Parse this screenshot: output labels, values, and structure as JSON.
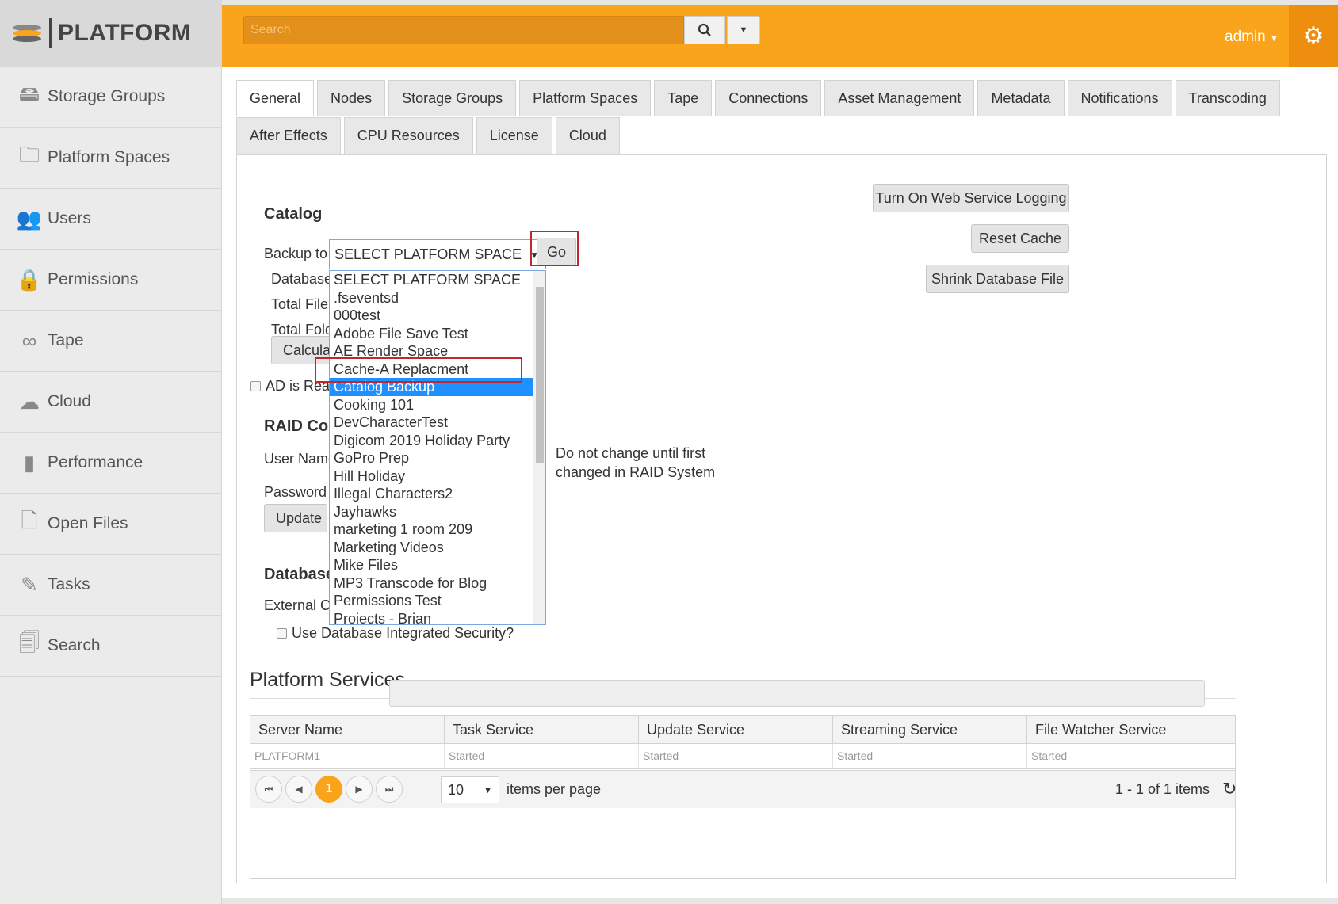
{
  "brand": {
    "logo_text": "PLATFORM"
  },
  "sidebar": {
    "items": [
      {
        "label": "Storage Groups",
        "icon": "storage-icon"
      },
      {
        "label": "Platform Spaces",
        "icon": "folder-icon"
      },
      {
        "label": "Users",
        "icon": "users-icon"
      },
      {
        "label": "Permissions",
        "icon": "lock-icon"
      },
      {
        "label": "Tape",
        "icon": "tape-icon"
      },
      {
        "label": "Cloud",
        "icon": "cloud-icon"
      },
      {
        "label": "Performance",
        "icon": "bar-chart-icon"
      },
      {
        "label": "Open Files",
        "icon": "file-icon"
      },
      {
        "label": "Tasks",
        "icon": "tasks-icon"
      },
      {
        "label": "Search",
        "icon": "search-doc-icon"
      }
    ]
  },
  "header": {
    "search_placeholder": "Search",
    "user": "admin",
    "colors": {
      "accent": "#f9a41b",
      "gear_bg": "#ee8e0f"
    }
  },
  "tabs_row1": [
    "General",
    "Nodes",
    "Storage Groups",
    "Platform Spaces",
    "Tape",
    "Connections",
    "Asset Management",
    "Metadata",
    "Notifications",
    "Transcoding"
  ],
  "tabs_row2": [
    "After Effects",
    "CPU Resources",
    "License",
    "Cloud"
  ],
  "catalog": {
    "title": "Catalog",
    "backup_label": "Backup to",
    "select_value": "SELECT PLATFORM SPACE",
    "go": "Go",
    "database_label": "Database",
    "total_files_label": "Total Files",
    "total_folders_label": "Total Fold",
    "calculate": "Calcula",
    "options": [
      "SELECT PLATFORM SPACE",
      ".fseventsd",
      "000test",
      "Adobe File Save Test",
      "AE Render Space",
      "Cache-A Replacment",
      "Catalog Backup",
      "Cooking 101",
      "DevCharacterTest",
      "Digicom 2019 Holiday Party",
      "GoPro Prep",
      "Hill Holiday",
      "Illegal Characters2",
      "Jayhawks",
      "marketing 1 room 209",
      "Marketing Videos",
      "Mike Files",
      "MP3 Transcode for Blog",
      "Permissions Test",
      "Projects - Brian"
    ],
    "selected_index": 6
  },
  "ad_label": "AD is Rea",
  "buttons": {
    "logging": "Turn On Web Service Logging",
    "reset_cache": "Reset Cache",
    "shrink": "Shrink Database File"
  },
  "raid": {
    "title": "RAID Co",
    "user_label": "User Name",
    "password_label": "Password",
    "update": "Update",
    "note_line1": "Do not change until first",
    "note_line2": "changed in RAID System"
  },
  "database": {
    "title": "Database",
    "external_label": "External Connection",
    "integrated_label": "Use Database Integrated Security?"
  },
  "services": {
    "title": "Platform Services",
    "columns": [
      "Server Name",
      "Task Service",
      "Update Service",
      "Streaming Service",
      "File Watcher Service"
    ],
    "rows": [
      [
        "PLATFORM1",
        "Started",
        "Started",
        "Started",
        "Started"
      ]
    ],
    "pager": {
      "current_page": "1",
      "per_page": "10",
      "per_page_label": "items per page",
      "summary": "1 - 1 of 1 items"
    }
  }
}
